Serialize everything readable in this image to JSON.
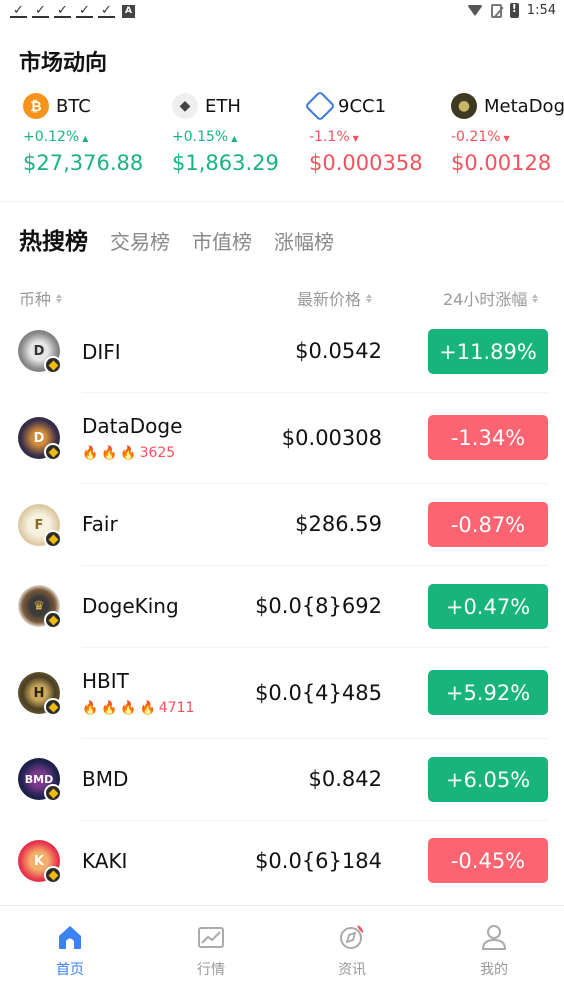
{
  "status_bar": {
    "time": "1:54",
    "app_icon_letter": "A"
  },
  "market": {
    "title": "市场动向",
    "tickers": [
      {
        "symbol": "BTC",
        "change": "+0.12%",
        "price": "$27,376.88",
        "direction": "up",
        "logo_color": "#f7931a",
        "logo_glyph": "₿"
      },
      {
        "symbol": "ETH",
        "change": "+0.15%",
        "price": "$1,863.29",
        "direction": "up",
        "logo_color": "#f2f2f2",
        "logo_glyph": "◆"
      },
      {
        "symbol": "9CC1",
        "change": "-1.1%",
        "price": "$0.000358",
        "direction": "down",
        "logo_color": "#ffffff",
        "logo_glyph": "⬡"
      },
      {
        "symbol": "MetaDoge",
        "change": "-0.21%",
        "price": "$0.00128",
        "direction": "down",
        "logo_color": "#3a3a2a",
        "logo_glyph": "●"
      }
    ]
  },
  "tabs": [
    "热搜榜",
    "交易榜",
    "市值榜",
    "涨幅榜"
  ],
  "table_header": {
    "coin": "币种",
    "price": "最新价格",
    "change": "24小时涨幅"
  },
  "rows": [
    {
      "name": "DIFI",
      "price": "$0.0542",
      "change": "+11.89%",
      "direction": "up",
      "hot": null,
      "logo_color": "#9a9a9a",
      "logo_text": "D"
    },
    {
      "name": "DataDoge",
      "price": "$0.00308",
      "change": "-1.34%",
      "direction": "down",
      "hot": "3625",
      "flames": 3,
      "logo_color": "#2d2a3a",
      "logo_text": "🐕"
    },
    {
      "name": "Fair",
      "price": "$286.59",
      "change": "-0.87%",
      "direction": "down",
      "hot": null,
      "logo_color": "#efe6d2",
      "logo_text": "F"
    },
    {
      "name": "DogeKing",
      "price": "$0.0{8}692",
      "change": "+0.47%",
      "direction": "up",
      "hot": null,
      "logo_color": "#ffffff",
      "logo_text": "♛"
    },
    {
      "name": "HBIT",
      "price": "$0.0{4}485",
      "change": "+5.92%",
      "direction": "up",
      "hot": "4711",
      "flames": 4,
      "logo_color": "#6b5a32",
      "logo_text": "H"
    },
    {
      "name": "BMD",
      "price": "$0.842",
      "change": "+6.05%",
      "direction": "up",
      "hot": null,
      "logo_color": "#1f2350",
      "logo_text": "BMD"
    },
    {
      "name": "KAKI",
      "price": "$0.0{6}184",
      "change": "-0.45%",
      "direction": "down",
      "hot": null,
      "logo_color": "#e8304a",
      "logo_text": "K"
    }
  ],
  "bottom_nav": [
    {
      "label": "首页",
      "icon": "home-icon",
      "active": true
    },
    {
      "label": "行情",
      "icon": "chart-icon",
      "active": false
    },
    {
      "label": "资讯",
      "icon": "news-icon",
      "active": false
    },
    {
      "label": "我的",
      "icon": "profile-icon",
      "active": false
    }
  ],
  "colors": {
    "up": "#17b57c",
    "down": "#f4515d",
    "accent": "#3b82f6"
  }
}
